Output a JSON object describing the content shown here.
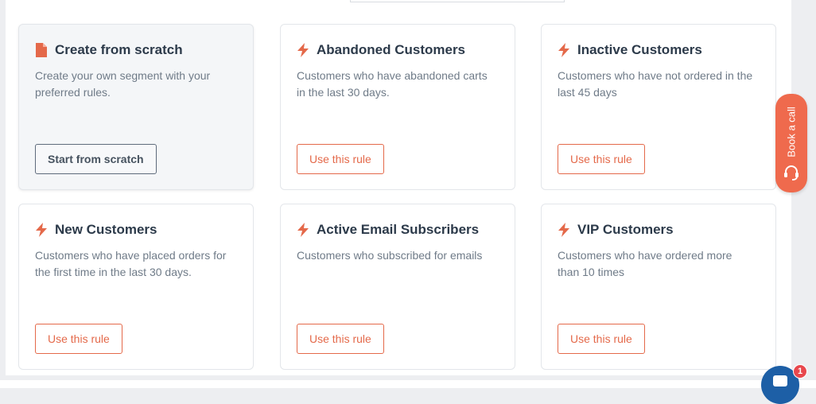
{
  "colors": {
    "accent": "#e4694a",
    "title": "#2c3a4a",
    "description": "#6f7b88",
    "chat": "#1d5fa6",
    "badge": "#e8474d"
  },
  "cards": [
    {
      "title": "Create from scratch",
      "icon": "document-icon",
      "description": "Create your own segment with your preferred rules.",
      "button": "Start from scratch"
    },
    {
      "title": "Abandoned Customers",
      "icon": "lightning-icon",
      "description": "Customers who have abandoned carts in the last 30 days.",
      "button": "Use this rule"
    },
    {
      "title": "Inactive Customers",
      "icon": "lightning-icon",
      "description": "Customers who have not ordered in the last 45 days",
      "button": "Use this rule"
    },
    {
      "title": "New Customers",
      "icon": "lightning-icon",
      "description": "Customers who have placed orders for the first time in the last 30 days.",
      "button": "Use this rule"
    },
    {
      "title": "Active Email Subscribers",
      "icon": "lightning-icon",
      "description": "Customers who subscribed for emails",
      "button": "Use this rule"
    },
    {
      "title": "VIP Customers",
      "icon": "lightning-icon",
      "description": "Customers who have ordered more than 10 times",
      "button": "Use this rule"
    }
  ],
  "book_call": {
    "label": "Book a call",
    "icon": "headset-icon"
  },
  "chat": {
    "icon": "chat-icon",
    "badge_count": "1"
  }
}
